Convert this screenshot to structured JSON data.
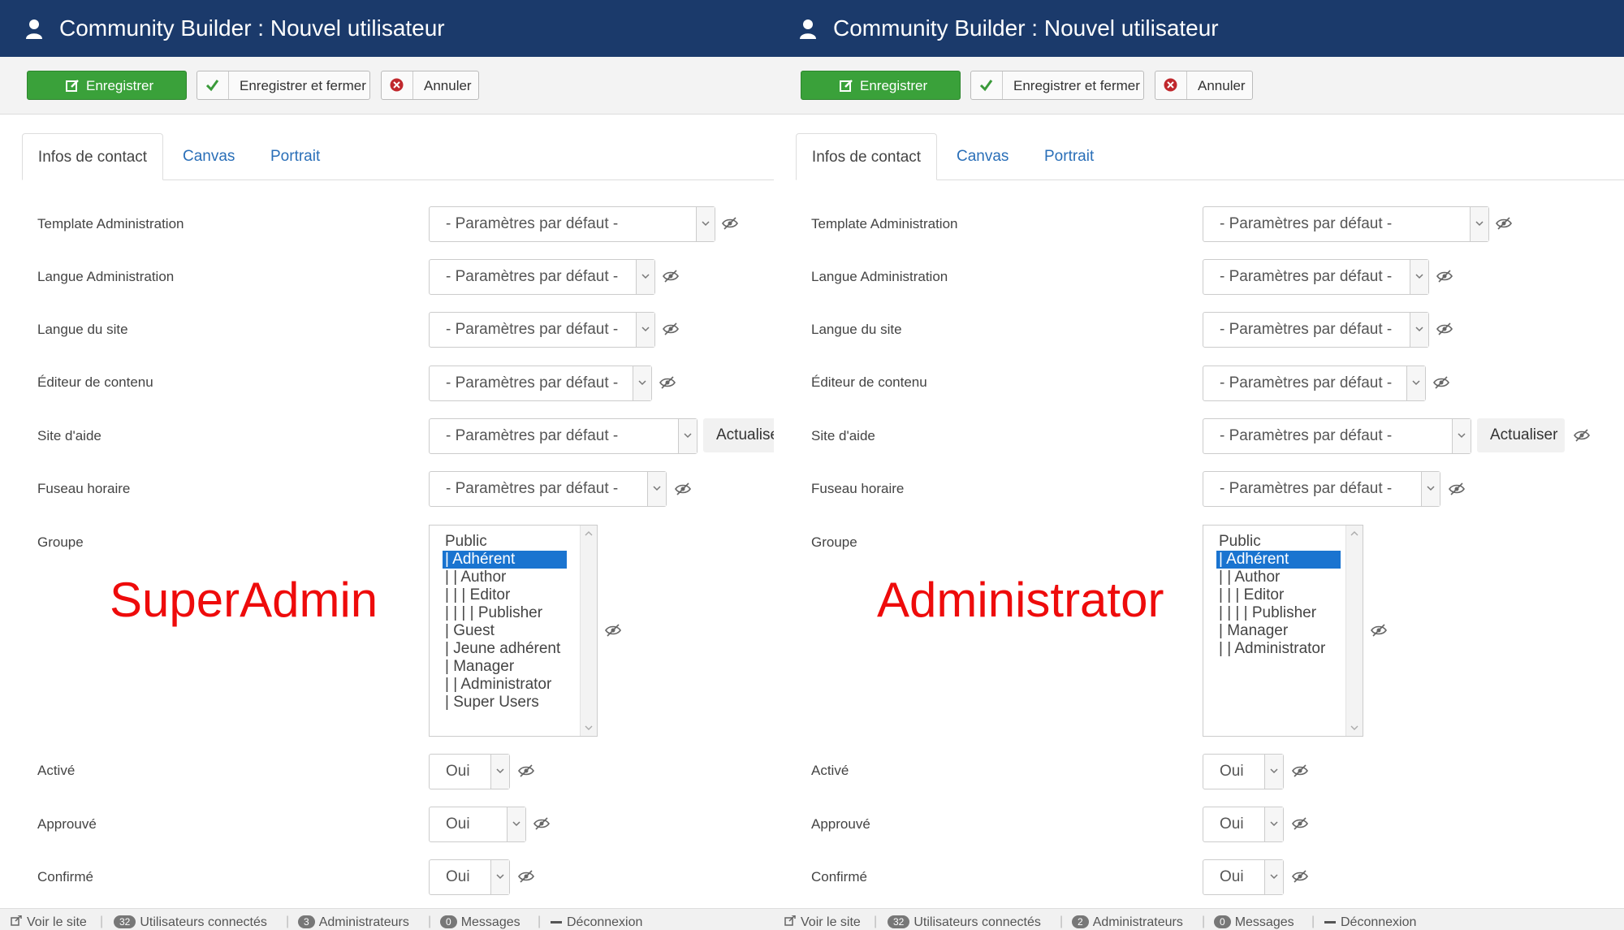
{
  "left": {
    "header": {
      "title": "Community Builder : Nouvel utilisateur"
    },
    "toolbar": {
      "save": "Enregistrer",
      "save_close": "Enregistrer et fermer",
      "cancel": "Annuler"
    },
    "tabs": [
      "Infos de contact",
      "Canvas",
      "Portrait"
    ],
    "fields": {
      "template_admin": {
        "label": "Template Administration",
        "value": "- Paramètres par défaut -"
      },
      "langue_admin": {
        "label": "Langue Administration",
        "value": "- Paramètres par défaut -"
      },
      "langue_site": {
        "label": "Langue du site",
        "value": "- Paramètres par défaut -"
      },
      "editeur": {
        "label": "Éditeur de contenu",
        "value": "- Paramètres par défaut -"
      },
      "site_aide": {
        "label": "Site d'aide",
        "value": "- Paramètres par défaut -",
        "button": "Actualiser"
      },
      "fuseau": {
        "label": "Fuseau horaire",
        "value": "- Paramètres par défaut -"
      },
      "groupe": {
        "label": "Groupe",
        "options": [
          "Public",
          "| Adhérent",
          "| | Author",
          "| | | Editor",
          "| | | | Publisher",
          "| Guest",
          "| Jeune adhérent",
          "| Manager",
          "| | Administrator",
          "| Super Users"
        ],
        "selected": "| Adhérent"
      },
      "active": {
        "label": "Activé",
        "value": "Oui"
      },
      "approuve": {
        "label": "Approuvé",
        "value": "Oui"
      },
      "confirme": {
        "label": "Confirmé",
        "value": "Oui"
      }
    },
    "overlay_label": "SuperAdmin",
    "footer": {
      "view_site": "Voir le site",
      "users_count": "32",
      "users_label": "Utilisateurs connectés",
      "admins_count": "3",
      "admins_label": "Administrateurs",
      "messages_count": "0",
      "messages_label": "Messages",
      "logout": "Déconnexion"
    }
  },
  "right": {
    "header": {
      "title": "Community Builder : Nouvel utilisateur"
    },
    "toolbar": {
      "save": "Enregistrer",
      "save_close": "Enregistrer et fermer",
      "cancel": "Annuler"
    },
    "tabs": [
      "Infos de contact",
      "Canvas",
      "Portrait"
    ],
    "fields": {
      "template_admin": {
        "label": "Template Administration",
        "value": "- Paramètres par défaut -"
      },
      "langue_admin": {
        "label": "Langue Administration",
        "value": "- Paramètres par défaut -"
      },
      "langue_site": {
        "label": "Langue du site",
        "value": "- Paramètres par défaut -"
      },
      "editeur": {
        "label": "Éditeur de contenu",
        "value": "- Paramètres par défaut -"
      },
      "site_aide": {
        "label": "Site d'aide",
        "value": "- Paramètres par défaut -",
        "button": "Actualiser"
      },
      "fuseau": {
        "label": "Fuseau horaire",
        "value": "- Paramètres par défaut -"
      },
      "groupe": {
        "label": "Groupe",
        "options": [
          "Public",
          "| Adhérent",
          "| | Author",
          "| | | Editor",
          "| | | | Publisher",
          "| Manager",
          "| | Administrator"
        ],
        "selected": "| Adhérent"
      },
      "active": {
        "label": "Activé",
        "value": "Oui"
      },
      "approuve": {
        "label": "Approuvé",
        "value": "Oui"
      },
      "confirme": {
        "label": "Confirmé",
        "value": "Oui"
      }
    },
    "overlay_label": "Administrator",
    "footer": {
      "view_site": "Voir le site",
      "users_count": "32",
      "users_label": "Utilisateurs connectés",
      "admins_count": "2",
      "admins_label": "Administrateurs",
      "messages_count": "0",
      "messages_label": "Messages",
      "logout": "Déconnexion"
    }
  },
  "colors": {
    "header_bg": "#1b3a6b",
    "save_green": "#3aa13a",
    "link_blue": "#2a6fb8",
    "overlay_red": "#ee0b0b",
    "selection_blue": "#1a74d0"
  },
  "icons": [
    "user-icon",
    "edit-icon",
    "check-icon",
    "cancel-icon",
    "chevron-down-icon",
    "eye-slash-icon",
    "external-link-icon",
    "minus-icon"
  ]
}
